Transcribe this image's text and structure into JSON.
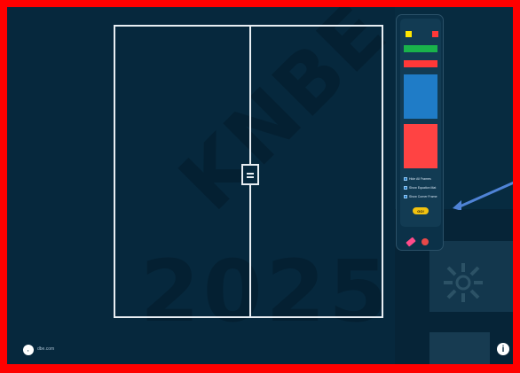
{
  "watermark": {
    "top": "KNBE",
    "bottom": "2025"
  },
  "board": {
    "left_label": "",
    "right_label": ""
  },
  "palette": {
    "options": [
      {
        "label": "Hide All Frames"
      },
      {
        "label": "Show Equation Mat"
      },
      {
        "label": "Show Corner Frame"
      }
    ],
    "go_label": "GO!"
  },
  "footer": {
    "logo_text": "dbe.com",
    "info_label": "i"
  },
  "colors": {
    "background": "#06283d",
    "frame": "#e8eef3",
    "border": "#ff0000",
    "yellow": "#ffe600",
    "red": "#ff3838",
    "green": "#19b34b",
    "blue": "#1f7cc7"
  }
}
